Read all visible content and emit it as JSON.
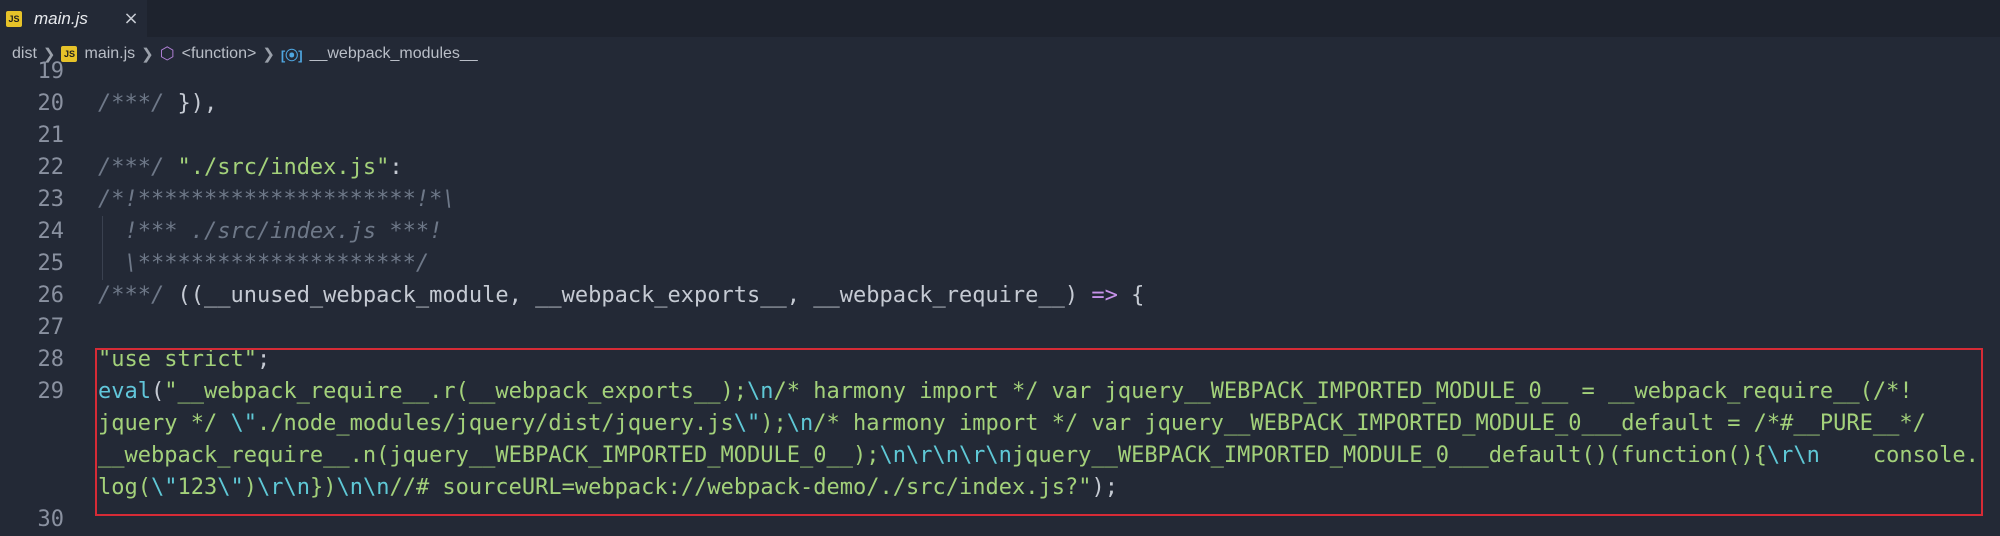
{
  "tab": {
    "icon": "js-file-icon",
    "badge": "JS",
    "label": "main.js",
    "close": "×"
  },
  "breadcrumb": {
    "items": [
      {
        "label": "dist",
        "icon": ""
      },
      {
        "label": "main.js",
        "icon": "js-file-icon"
      },
      {
        "label": "<function>",
        "icon": "cube-icon"
      },
      {
        "label": "__webpack_modules__",
        "icon": "reference-icon"
      }
    ]
  },
  "editor": {
    "lines": [
      {
        "n": "19",
        "segs": []
      },
      {
        "n": "20",
        "segs": [
          [
            "cm",
            "/***/ "
          ],
          [
            "",
            "}),"
          ]
        ]
      },
      {
        "n": "21",
        "segs": []
      },
      {
        "n": "22",
        "segs": [
          [
            "cm",
            "/***/ "
          ],
          [
            "str",
            "\"./src/index.js\""
          ],
          [
            "",
            ":"
          ]
        ]
      },
      {
        "n": "23",
        "segs": [
          [
            "cm",
            "/*!*********************!*\\"
          ]
        ]
      },
      {
        "n": "24",
        "segs": [
          [
            "cm",
            "  !*** ./src/index.js ***!"
          ]
        ]
      },
      {
        "n": "25",
        "segs": [
          [
            "cm",
            "  \\*********************/"
          ]
        ]
      },
      {
        "n": "26",
        "segs": [
          [
            "cm",
            "/***/ "
          ],
          [
            "",
            "((__unused_webpack_module, __webpack_exports__, __webpack_require__) "
          ],
          [
            "op",
            "=>"
          ],
          [
            "",
            " {"
          ]
        ]
      },
      {
        "n": "27",
        "segs": []
      },
      {
        "n": "28",
        "segs": [
          [
            "str",
            "\"use strict\""
          ],
          [
            "",
            ";"
          ]
        ]
      },
      {
        "n": "29",
        "segs": [
          [
            "fn",
            "eval"
          ],
          [
            "",
            "("
          ],
          [
            "str",
            "\"__webpack_require__.r(__webpack_exports__);"
          ],
          [
            "esc",
            "\\n"
          ],
          [
            "str",
            "/* harmony import */ var jquery__WEBPACK_IMPORTED_MODULE_0__ = __webpack_require__(/*!"
          ]
        ]
      },
      {
        "n": "",
        "segs": [
          [
            "str",
            "jquery */ "
          ],
          [
            "esc",
            "\\\""
          ],
          [
            "str",
            "./node_modules/jquery/dist/jquery.js"
          ],
          [
            "esc",
            "\\\""
          ],
          [
            "str",
            ");"
          ],
          [
            "esc",
            "\\n"
          ],
          [
            "str",
            "/* harmony import */ var jquery__WEBPACK_IMPORTED_MODULE_0___default = /*#__PURE__*/"
          ]
        ]
      },
      {
        "n": "",
        "segs": [
          [
            "str",
            "__webpack_require__.n(jquery__WEBPACK_IMPORTED_MODULE_0__);"
          ],
          [
            "esc",
            "\\n\\r\\n\\r\\n"
          ],
          [
            "str",
            "jquery__WEBPACK_IMPORTED_MODULE_0___default()(function(){"
          ],
          [
            "esc",
            "\\r\\n"
          ],
          [
            "str",
            "    console."
          ]
        ]
      },
      {
        "n": "",
        "segs": [
          [
            "str",
            "log("
          ],
          [
            "esc",
            "\\\""
          ],
          [
            "str",
            "123"
          ],
          [
            "esc",
            "\\\""
          ],
          [
            "str",
            ")"
          ],
          [
            "esc",
            "\\r\\n"
          ],
          [
            "str",
            "})"
          ],
          [
            "esc",
            "\\n\\n"
          ],
          [
            "str",
            "//# sourceURL=webpack://webpack-demo/./src/index.js?\""
          ],
          [
            "",
            ");"
          ]
        ]
      },
      {
        "n": "30",
        "segs": []
      }
    ]
  }
}
